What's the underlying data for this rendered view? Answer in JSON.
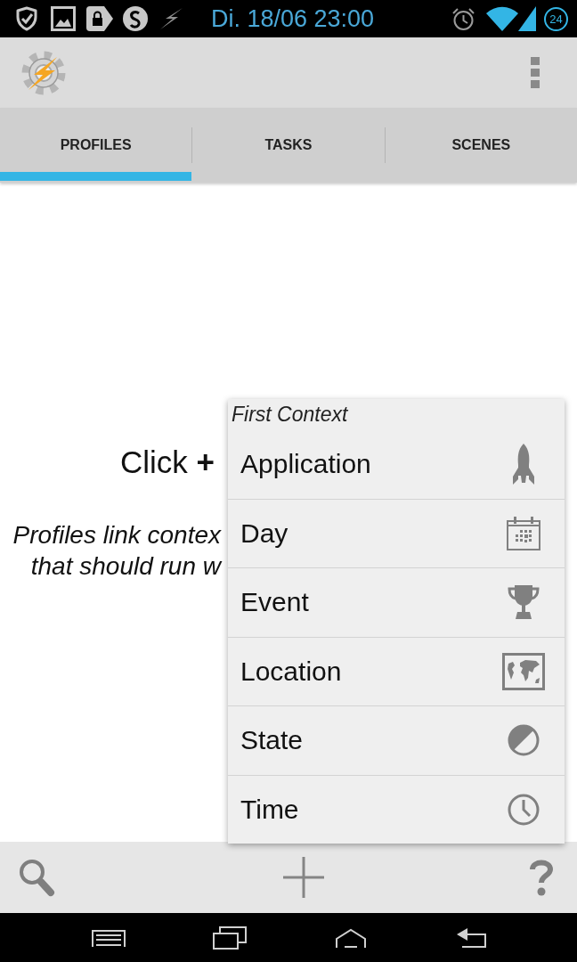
{
  "status_bar": {
    "time": "Di. 18/06 23:00",
    "battery_label": "24"
  },
  "tabs": [
    {
      "label": "PROFILES",
      "selected": true
    },
    {
      "label": "TASKS",
      "selected": false
    },
    {
      "label": "SCENES",
      "selected": false
    }
  ],
  "empty_state": {
    "heading": "Click **+**",
    "description_lines": [
      "Profiles link contex",
      "that should run w"
    ]
  },
  "context_menu": {
    "title": "First Context",
    "items": [
      {
        "label": "Application"
      },
      {
        "label": "Day"
      },
      {
        "label": "Event"
      },
      {
        "label": "Location"
      },
      {
        "label": "State"
      },
      {
        "label": "Time"
      }
    ]
  }
}
